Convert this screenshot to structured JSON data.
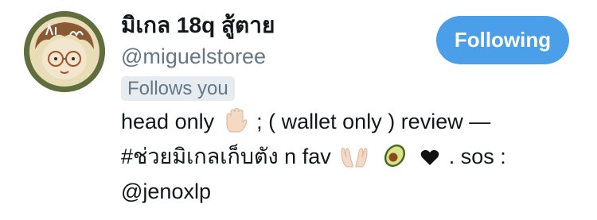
{
  "profile": {
    "display_name": "มิเกล 18q สู้ตาย",
    "handle": "@miguelstoree",
    "follows_you_label": "Follows you",
    "follow_button_label": "Following"
  },
  "bio": {
    "line1_text": "head only",
    "line1_rest": "; ( wallet only ) review —",
    "line2_hashtag": "#ช่วยมิเกลเก็บตัง n fav",
    "line2_rest": ". sos :",
    "line3_mention": "@jenoxlp",
    "emoji_icons": [
      "raised-hand-icon",
      "open-hands-icon",
      "avocado-icon",
      "black-heart-icon"
    ]
  },
  "colors": {
    "accent": "#4a9fe8",
    "secondary_text": "#657786",
    "badge_bg": "#e6ecf0",
    "primary_text": "#14171a"
  }
}
